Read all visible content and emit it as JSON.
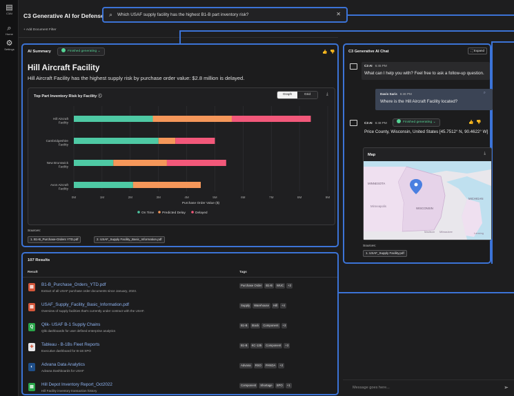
{
  "rail": [
    {
      "label": "C3AI",
      "icon": "logo-icon"
    },
    {
      "label": "Home",
      "icon": "search-icon"
    },
    {
      "label": "Settings",
      "icon": "gear-icon"
    }
  ],
  "header": {
    "title": "C3 Generative AI for Defense",
    "search_value": "Which USAF supply facility has the highest B1-B part inventory risk?",
    "add_filter": "+ Add Document Filter"
  },
  "summary": {
    "label": "AI Summary",
    "status": "Finished generating",
    "facility_title": "Hill Aircraft Facility",
    "facility_desc": "Hill Aircraft Facility has the highest supply risk by purchase order value: $2.8 million is delayed.",
    "chart_card_title": "Top Part Inventory Risk by Facility",
    "view_graph": "Graph",
    "view_grid": "Grid",
    "sources_label": "Sources:",
    "sources": [
      "1. B1-B_Purchase-Orders YTD.pdf",
      "2. USAF_Supply Facility_Basic_Information.pdf"
    ]
  },
  "chart_data": {
    "type": "bar",
    "orientation": "horizontal",
    "stacked": true,
    "title": "Top Part Inventory Risk by Facility",
    "xlabel": "Purchase Order Value ($)",
    "ylabel": "",
    "categories": [
      "Hill Aircraft Facility",
      "Cambridgeshire Facility",
      "New Brunswick Facility",
      "Avon Aircraft Facility"
    ],
    "series": [
      {
        "name": "On Time",
        "color": "#4ec9a4",
        "values": [
          2.8,
          3.0,
          1.4,
          2.1
        ]
      },
      {
        "name": "Predicted Delay",
        "color": "#f5975a",
        "values": [
          2.8,
          0.6,
          1.9,
          2.4
        ]
      },
      {
        "name": "Delayed",
        "color": "#f2587a",
        "values": [
          2.8,
          1.4,
          2.1,
          0
        ]
      }
    ],
    "xlim": [
      0,
      9
    ],
    "xticks": [
      "0M",
      "1M",
      "2M",
      "3M",
      "4M",
      "5M",
      "6M",
      "7M",
      "8M",
      "9M"
    ],
    "grid": true,
    "legend_position": "bottom"
  },
  "results": {
    "count_label": "107 Results",
    "col_result": "Result",
    "col_tags": "Tags",
    "items": [
      {
        "name": "B1-B_Purchase_Orders_YTD.pdf",
        "desc": "Extract of all USAF purchase order documents since January, 2023.",
        "icon": "pdf-icon",
        "icon_glyph": "▤",
        "icon_color": "#d4573b",
        "tags": [
          "Purchase Order",
          "B1-B",
          "WUC",
          "+2"
        ]
      },
      {
        "name": "USAF_Supply_Facility_Basic_Information.pdf",
        "desc": "Overview of supply facilities that's currently under contract with the USAF.",
        "icon": "pdf-icon",
        "icon_glyph": "▤",
        "icon_color": "#d4573b",
        "tags": [
          "Supply",
          "Warehouse",
          "Hill",
          "+4"
        ]
      },
      {
        "name": "Qlik- USAF B-1 Supply Chains",
        "desc": "Qlik dashboards for user defined enterprise analytics",
        "icon": "qlik-icon",
        "icon_glyph": "Q",
        "icon_color": "#2aa64a",
        "tags": [
          "B1-B",
          "Stock",
          "Component",
          "+3"
        ]
      },
      {
        "name": "Tableau - B-1Bs Fleet Reports",
        "desc": "Executive dashboard for B-1B SPO",
        "icon": "tableau-icon",
        "icon_glyph": "✚",
        "icon_color": "#e8e8ea",
        "tags": [
          "B1-B",
          "KC-135",
          "Component",
          "+3"
        ]
      },
      {
        "name": "Advana Data Analytics",
        "desc": "Advana Dashboards for USAF",
        "icon": "advana-icon",
        "icon_glyph": "◐",
        "icon_color": "#1f4f8a",
        "tags": [
          "Advana",
          "RSO",
          "PANDA",
          "+2"
        ]
      },
      {
        "name": "Hill Depot Inventory Report_Oct2022",
        "desc": "Hill Facility inventory transaction history",
        "icon": "sheet-icon",
        "icon_glyph": "▤",
        "icon_color": "#2aa64a",
        "tags": [
          "Component",
          "Shortage",
          "SPO",
          "+1"
        ]
      }
    ]
  },
  "chat": {
    "title": "C3 Generative AI Chat",
    "expand": "Expand",
    "bot_name": "C3 AI",
    "msg1_time": "6:45 PM",
    "msg1": "What can I help you with? Feel free to ask a follow-up question.",
    "user_name": "Davis Saris",
    "user_time": "6:46 PM",
    "user_msg": "Where is the Hill Aircraft Facility located?",
    "msg2_time": "6:48 PM",
    "msg2_status": "Finished generating",
    "msg2": "Price County, Wisconsin, United States [45.7512° N, 90.4622° W]",
    "map_title": "Map",
    "map_labels": [
      "MINNESOTA",
      "Minneapolis",
      "WISCONSIN",
      "MICHIGAN",
      "Madison",
      "Milwaukee",
      "Lansing"
    ],
    "sources_label": "Sources:",
    "source": "1. USAF_Supply Facility.pdf",
    "input_placeholder": "Message goes here..."
  }
}
